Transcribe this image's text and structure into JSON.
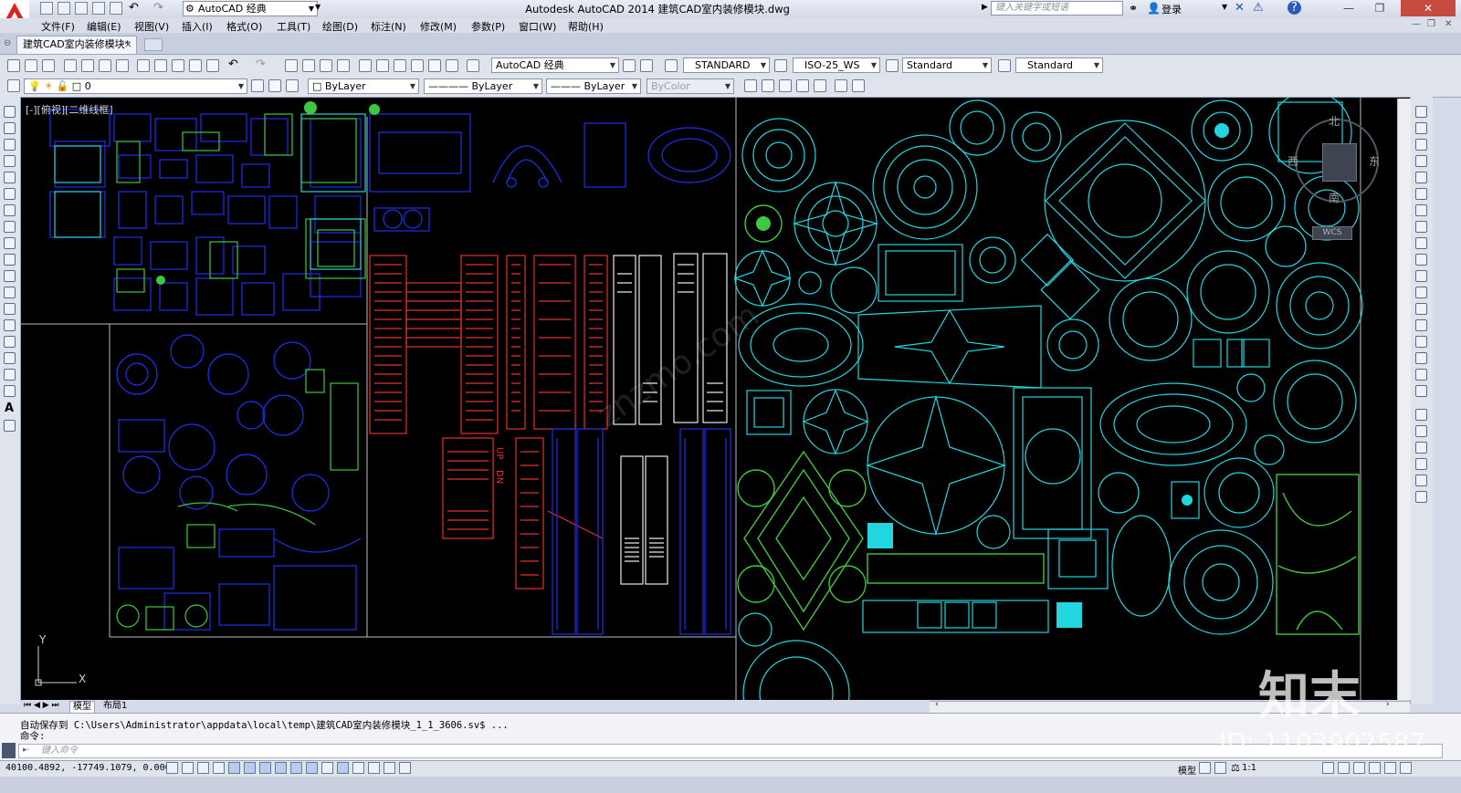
{
  "titlebar": {
    "workspace": "AutoCAD 经典",
    "window_title": "Autodesk AutoCAD 2014    建筑CAD室内装修模块.dwg",
    "search_placeholder": "键入关键字或短语",
    "login": "登录"
  },
  "menu": [
    "文件(F)",
    "编辑(E)",
    "视图(V)",
    "插入(I)",
    "格式(O)",
    "工具(T)",
    "绘图(D)",
    "标注(N)",
    "修改(M)",
    "参数(P)",
    "窗口(W)",
    "帮助(H)"
  ],
  "document_tab": {
    "label": "建筑CAD室内装修模块*",
    "close": "×"
  },
  "toolbar": {
    "workspace2": "AutoCAD 经典",
    "text_style": "STANDARD",
    "dim_style": "ISO-25_WS",
    "table_style": "Standard",
    "multileader_style": "Standard",
    "layer": "0",
    "color": "ByLayer",
    "linetype": "ByLayer",
    "lineweight": "ByLayer",
    "plot_style": "ByColor"
  },
  "viewport": {
    "label": "[-][俯视][二维线框]"
  },
  "viewcube": {
    "north": "北",
    "south": "南",
    "east": "东",
    "west": "西",
    "wcs": "WCS"
  },
  "ucs": {
    "x": "X",
    "y": "Y"
  },
  "drawing_text": {
    "up": "UP",
    "dn": "DN"
  },
  "layout_tabs": [
    "模型",
    "布局1"
  ],
  "command": {
    "history": "自动保存到 C:\\Users\\Administrator\\appdata\\local\\temp\\建筑CAD室内装修模块_1_1_3606.sv$ ...",
    "prompt": "命令:",
    "input_placeholder": "键入命令"
  },
  "status": {
    "coords": "40100.4892, -17749.1079, 0.0000",
    "model": "模型",
    "scale": "1:1"
  },
  "watermark": {
    "brand": "知末",
    "id": "ID: 1103902587",
    "site": "znzmo.com"
  },
  "colors": {
    "canvas": "#000000",
    "cyan": "#22d6e0",
    "blue": "#1f2ff0",
    "red": "#e53030",
    "green": "#3ec83e",
    "white": "#e8e8e8"
  }
}
